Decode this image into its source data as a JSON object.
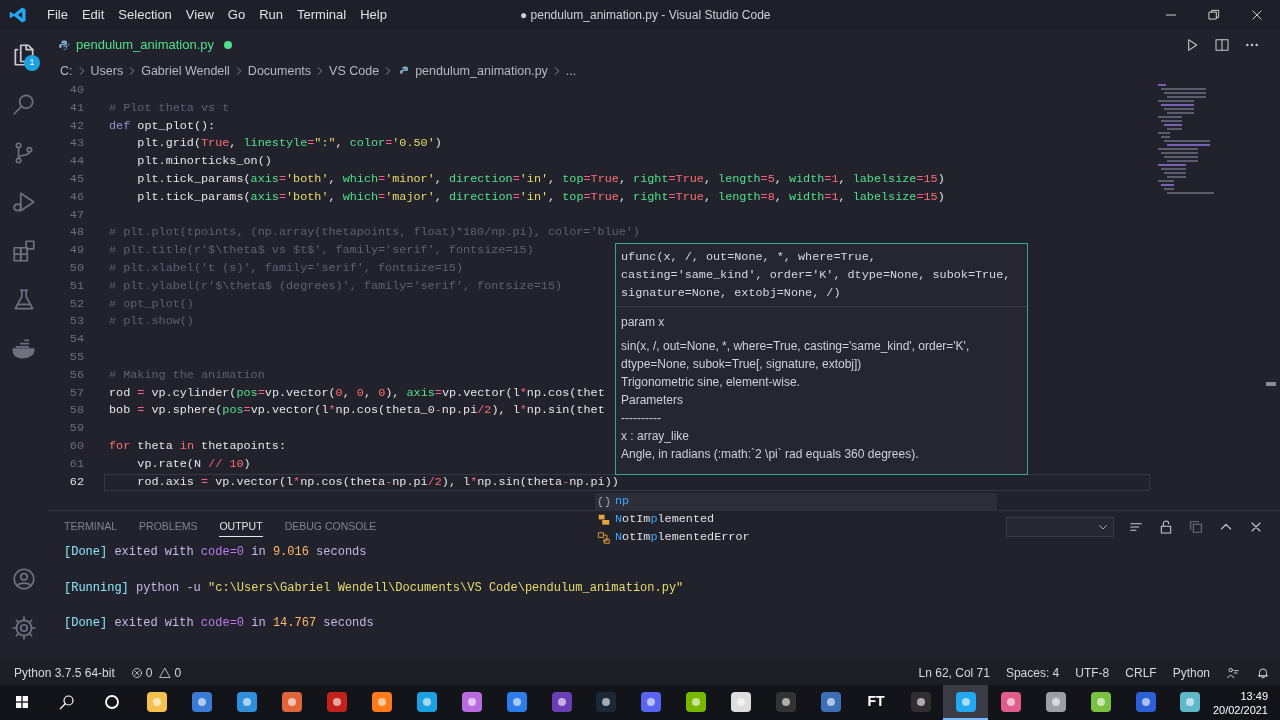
{
  "title_bar": {
    "menus": [
      "File",
      "Edit",
      "Selection",
      "View",
      "Go",
      "Run",
      "Terminal",
      "Help"
    ],
    "title": "● pendulum_animation.py - Visual Studio Code"
  },
  "activity_bar": {
    "items": [
      {
        "kind": "explorer",
        "selected": true,
        "badge": "1"
      },
      {
        "kind": "search",
        "selected": false
      },
      {
        "kind": "scm",
        "selected": false
      },
      {
        "kind": "debug",
        "selected": false
      },
      {
        "kind": "extensions",
        "selected": false
      },
      {
        "kind": "testing",
        "selected": false
      },
      {
        "kind": "docker",
        "selected": false
      }
    ],
    "bottom": [
      {
        "kind": "accounts",
        "selected": false
      },
      {
        "kind": "settings",
        "selected": false
      }
    ]
  },
  "tab": {
    "label": "pendulum_animation.py",
    "modified": true
  },
  "breadcrumb": [
    "C:",
    "Users",
    "Gabriel Wendell",
    "Documents",
    "VS Code",
    "pendulum_animation.py",
    "..."
  ],
  "editor": {
    "lines": [
      {
        "number": "40"
      },
      {
        "number": "41",
        "tokens": [
          {
            "kind": "com",
            "text": "# Plot theta vs t"
          }
        ]
      },
      {
        "number": "42",
        "tokens": [
          {
            "kind": "kw",
            "text": "def"
          },
          {
            "kind": "txt",
            "text": " opt_plot():"
          }
        ]
      },
      {
        "number": "43",
        "tokens": [
          {
            "kind": "txt",
            "text": "    plt.grid("
          },
          {
            "kind": "const",
            "text": "True"
          },
          {
            "kind": "txt",
            "text": ", "
          },
          {
            "kind": "param",
            "text": "linestyle"
          },
          {
            "kind": "op",
            "text": "="
          },
          {
            "kind": "str",
            "text": "\":\""
          },
          {
            "kind": "txt",
            "text": ", "
          },
          {
            "kind": "param",
            "text": "color"
          },
          {
            "kind": "op",
            "text": "="
          },
          {
            "kind": "str",
            "text": "'0.50'"
          },
          {
            "kind": "txt",
            "text": ")"
          }
        ]
      },
      {
        "number": "44",
        "tokens": [
          {
            "kind": "txt",
            "text": "    plt.minorticks_on()"
          }
        ]
      },
      {
        "number": "45",
        "tokens": [
          {
            "kind": "txt",
            "text": "    plt.tick_params("
          },
          {
            "kind": "param",
            "text": "axis"
          },
          {
            "kind": "op",
            "text": "="
          },
          {
            "kind": "str",
            "text": "'both'"
          },
          {
            "kind": "txt",
            "text": ", "
          },
          {
            "kind": "param",
            "text": "which"
          },
          {
            "kind": "op",
            "text": "="
          },
          {
            "kind": "str",
            "text": "'minor'"
          },
          {
            "kind": "txt",
            "text": ", "
          },
          {
            "kind": "param",
            "text": "direction"
          },
          {
            "kind": "op",
            "text": "="
          },
          {
            "kind": "str",
            "text": "'in'"
          },
          {
            "kind": "txt",
            "text": ", "
          },
          {
            "kind": "param",
            "text": "top"
          },
          {
            "kind": "op",
            "text": "="
          },
          {
            "kind": "const",
            "text": "True"
          },
          {
            "kind": "txt",
            "text": ", "
          },
          {
            "kind": "param",
            "text": "right"
          },
          {
            "kind": "op",
            "text": "="
          },
          {
            "kind": "const",
            "text": "True"
          },
          {
            "kind": "txt",
            "text": ", "
          },
          {
            "kind": "param",
            "text": "length"
          },
          {
            "kind": "op",
            "text": "="
          },
          {
            "kind": "num",
            "text": "5"
          },
          {
            "kind": "txt",
            "text": ", "
          },
          {
            "kind": "param",
            "text": "width"
          },
          {
            "kind": "op",
            "text": "="
          },
          {
            "kind": "num",
            "text": "1"
          },
          {
            "kind": "txt",
            "text": ", "
          },
          {
            "kind": "param",
            "text": "labelsize"
          },
          {
            "kind": "op",
            "text": "="
          },
          {
            "kind": "num",
            "text": "15"
          },
          {
            "kind": "txt",
            "text": ")"
          }
        ]
      },
      {
        "number": "46",
        "tokens": [
          {
            "kind": "txt",
            "text": "    plt.tick_params("
          },
          {
            "kind": "param",
            "text": "axis"
          },
          {
            "kind": "op",
            "text": "="
          },
          {
            "kind": "str",
            "text": "'both'"
          },
          {
            "kind": "txt",
            "text": ", "
          },
          {
            "kind": "param",
            "text": "which"
          },
          {
            "kind": "op",
            "text": "="
          },
          {
            "kind": "str",
            "text": "'major'"
          },
          {
            "kind": "txt",
            "text": ", "
          },
          {
            "kind": "param",
            "text": "direction"
          },
          {
            "kind": "op",
            "text": "="
          },
          {
            "kind": "str",
            "text": "'in'"
          },
          {
            "kind": "txt",
            "text": ", "
          },
          {
            "kind": "param",
            "text": "top"
          },
          {
            "kind": "op",
            "text": "="
          },
          {
            "kind": "const",
            "text": "True"
          },
          {
            "kind": "txt",
            "text": ", "
          },
          {
            "kind": "param",
            "text": "right"
          },
          {
            "kind": "op",
            "text": "="
          },
          {
            "kind": "const",
            "text": "True"
          },
          {
            "kind": "txt",
            "text": ", "
          },
          {
            "kind": "param",
            "text": "length"
          },
          {
            "kind": "op",
            "text": "="
          },
          {
            "kind": "num",
            "text": "8"
          },
          {
            "kind": "txt",
            "text": ", "
          },
          {
            "kind": "param",
            "text": "width"
          },
          {
            "kind": "op",
            "text": "="
          },
          {
            "kind": "num",
            "text": "1"
          },
          {
            "kind": "txt",
            "text": ", "
          },
          {
            "kind": "param",
            "text": "labelsize"
          },
          {
            "kind": "op",
            "text": "="
          },
          {
            "kind": "num",
            "text": "15"
          },
          {
            "kind": "txt",
            "text": ")"
          }
        ]
      },
      {
        "number": "47"
      },
      {
        "number": "48",
        "tokens": [
          {
            "kind": "com",
            "text": "# plt.plot(tpoints, (np.array(thetapoints, float)*180/np.pi), color='blue')"
          }
        ]
      },
      {
        "number": "49",
        "tokens": [
          {
            "kind": "com",
            "text": "# plt.title(r'$\\theta$ vs $t$', family='serif', fontsize=15)"
          }
        ]
      },
      {
        "number": "50",
        "tokens": [
          {
            "kind": "com",
            "text": "# plt.xlabel('t (s)', family='serif', fontsize=15)"
          }
        ]
      },
      {
        "number": "51",
        "tokens": [
          {
            "kind": "com",
            "text": "# plt.ylabel(r'$\\theta$ (degrees)', family='serif', fontsize=15)"
          }
        ]
      },
      {
        "number": "52",
        "tokens": [
          {
            "kind": "com",
            "text": "# opt_plot()"
          }
        ]
      },
      {
        "number": "53",
        "tokens": [
          {
            "kind": "com",
            "text": "# plt.show()"
          }
        ]
      },
      {
        "number": "54"
      },
      {
        "number": "55"
      },
      {
        "number": "56",
        "tokens": [
          {
            "kind": "com",
            "text": "# Making the animation"
          }
        ]
      },
      {
        "number": "57",
        "tokens": [
          {
            "kind": "txt",
            "text": "rod "
          },
          {
            "kind": "op",
            "text": "="
          },
          {
            "kind": "txt",
            "text": " vp.cylinder("
          },
          {
            "kind": "param",
            "text": "pos"
          },
          {
            "kind": "op",
            "text": "="
          },
          {
            "kind": "txt",
            "text": "vp.vector("
          },
          {
            "kind": "num",
            "text": "0"
          },
          {
            "kind": "txt",
            "text": ", "
          },
          {
            "kind": "num",
            "text": "0"
          },
          {
            "kind": "txt",
            "text": ", "
          },
          {
            "kind": "num",
            "text": "0"
          },
          {
            "kind": "txt",
            "text": "), "
          },
          {
            "kind": "param",
            "text": "axis"
          },
          {
            "kind": "op",
            "text": "="
          },
          {
            "kind": "txt",
            "text": "vp.vector(l"
          },
          {
            "kind": "op",
            "text": "*"
          },
          {
            "kind": "txt",
            "text": "np.cos(thet"
          }
        ]
      },
      {
        "number": "58",
        "tokens": [
          {
            "kind": "txt",
            "text": "bob "
          },
          {
            "kind": "op",
            "text": "="
          },
          {
            "kind": "txt",
            "text": " vp.sphere("
          },
          {
            "kind": "param",
            "text": "pos"
          },
          {
            "kind": "op",
            "text": "="
          },
          {
            "kind": "txt",
            "text": "vp.vector(l"
          },
          {
            "kind": "op",
            "text": "*"
          },
          {
            "kind": "txt",
            "text": "np.cos(theta_0"
          },
          {
            "kind": "op",
            "text": "-"
          },
          {
            "kind": "txt",
            "text": "np.pi"
          },
          {
            "kind": "op",
            "text": "/"
          },
          {
            "kind": "num",
            "text": "2"
          },
          {
            "kind": "txt",
            "text": "), l"
          },
          {
            "kind": "op",
            "text": "*"
          },
          {
            "kind": "txt",
            "text": "np.sin(thet"
          }
        ]
      },
      {
        "number": "59"
      },
      {
        "number": "60",
        "tokens": [
          {
            "kind": "kw2",
            "text": "for"
          },
          {
            "kind": "txt",
            "text": " theta "
          },
          {
            "kind": "kw2",
            "text": "in"
          },
          {
            "kind": "txt",
            "text": " thetapoints:"
          }
        ]
      },
      {
        "number": "61",
        "tokens": [
          {
            "kind": "txt",
            "text": "    vp.rate(N "
          },
          {
            "kind": "op",
            "text": "//"
          },
          {
            "kind": "num",
            "text": " 10"
          },
          {
            "kind": "txt",
            "text": ")"
          }
        ]
      },
      {
        "number": "62",
        "current": true,
        "tokens": [
          {
            "kind": "txt",
            "text": "    rod.axis "
          },
          {
            "kind": "op",
            "text": "="
          },
          {
            "kind": "txt",
            "text": " vp.vector(l"
          },
          {
            "kind": "op",
            "text": "*"
          },
          {
            "kind": "txt",
            "text": "np.cos(theta"
          },
          {
            "kind": "op",
            "text": "-"
          },
          {
            "kind": "txt",
            "text": "np.pi"
          },
          {
            "kind": "op",
            "text": "/"
          },
          {
            "kind": "num",
            "text": "2"
          },
          {
            "kind": "txt",
            "text": "), l"
          },
          {
            "kind": "op",
            "text": "*"
          },
          {
            "kind": "txt",
            "text": "np.sin(theta"
          },
          {
            "kind": "op",
            "text": "-"
          },
          {
            "kind": "txt",
            "text": "np.pi))"
          }
        ]
      }
    ]
  },
  "hover": {
    "signature": [
      "ufunc(x, /, out=None, *, where=True,",
      "casting='same_kind', order='K', dtype=None, subok=True,",
      "signature=None, extobj=None, /)"
    ],
    "docs": [
      "param x",
      "sin(x, /, out=None, *, where=True, casting='same_kind', order='K', dtype=None, subok=True[, signature, extobj])",
      "Trigonometric sine, element-wise.",
      "Parameters",
      "----------",
      "x : array_like",
      "Angle, in radians (:math:`2 \\pi` rad equals 360 degrees)."
    ]
  },
  "suggest": [
    {
      "kind": "module",
      "selected": true,
      "segments": [
        {
          "text": "np",
          "match": true
        }
      ]
    },
    {
      "kind": "constant",
      "selected": false,
      "segments": [
        {
          "text": "N",
          "match": true
        },
        {
          "text": "otIm",
          "match": false
        },
        {
          "text": "p",
          "match": true
        },
        {
          "text": "lemented",
          "match": false
        }
      ]
    },
    {
      "kind": "class",
      "selected": false,
      "segments": [
        {
          "text": "N",
          "match": true
        },
        {
          "text": "otIm",
          "match": false
        },
        {
          "text": "p",
          "match": true
        },
        {
          "text": "lementedError",
          "match": false
        }
      ]
    }
  ],
  "panel": {
    "tabs": [
      {
        "label": "TERMINAL",
        "selected": false
      },
      {
        "label": "PROBLEMS",
        "selected": false
      },
      {
        "label": "OUTPUT",
        "selected": true
      },
      {
        "label": "DEBUG CONSOLE",
        "selected": false
      }
    ],
    "output": [
      [
        {
          "kind": "tag",
          "text": "[Done]"
        },
        {
          "kind": "txt",
          "text": " exited with "
        },
        {
          "kind": "key",
          "text": "code=0"
        },
        {
          "kind": "txt",
          "text": " in "
        },
        {
          "kind": "num",
          "text": "9.016"
        },
        {
          "kind": "txt",
          "text": " seconds"
        }
      ],
      [
        {
          "kind": "tag",
          "text": "[Running]"
        },
        {
          "kind": "cmd",
          "text": " python -u "
        },
        {
          "kind": "path",
          "text": "\"c:\\Users\\Gabriel Wendell\\Documents\\VS Code\\pendulum_animation.py\""
        }
      ],
      [
        {
          "kind": "tag",
          "text": "[Done]"
        },
        {
          "kind": "txt",
          "text": " exited with "
        },
        {
          "kind": "key",
          "text": "code=0"
        },
        {
          "kind": "txt",
          "text": " in "
        },
        {
          "kind": "num",
          "text": "14.767"
        },
        {
          "kind": "txt",
          "text": " seconds"
        }
      ]
    ]
  },
  "status_bar": {
    "interpreter": "Python 3.7.5 64-bit",
    "errors": "0",
    "warnings": "0",
    "right": [
      "Ln 62, Col 71",
      "Spaces: 4",
      "UTF-8",
      "CRLF",
      "Python"
    ]
  },
  "taskbar": {
    "apps": [
      {
        "kind": "start",
        "selected": false
      },
      {
        "kind": "search",
        "selected": false
      },
      {
        "kind": "cortana",
        "selected": false
      },
      {
        "kind": "app",
        "color": "#f2c14e",
        "selected": false
      },
      {
        "kind": "app",
        "color": "#3a7bd5",
        "selected": false
      },
      {
        "kind": "app",
        "color": "#2f8fdc",
        "selected": false
      },
      {
        "kind": "app",
        "color": "#e0663a",
        "selected": false
      },
      {
        "kind": "app",
        "color": "#c4201c",
        "selected": false
      },
      {
        "kind": "app",
        "color": "#ff7a18",
        "selected": false
      },
      {
        "kind": "app",
        "color": "#1ba1e2",
        "selected": false
      },
      {
        "kind": "app",
        "color": "#b86be0",
        "selected": false
      },
      {
        "kind": "app",
        "color": "#2b7de9",
        "selected": false
      },
      {
        "kind": "app",
        "color": "#6a3fb5",
        "selected": false
      },
      {
        "kind": "app",
        "color": "#1b2838",
        "selected": false
      },
      {
        "kind": "app",
        "color": "#5865f2",
        "selected": false
      },
      {
        "kind": "app",
        "color": "#76b900",
        "selected": false
      },
      {
        "kind": "app",
        "color": "#dddddd",
        "selected": false
      },
      {
        "kind": "app",
        "color": "#333333",
        "selected": false
      },
      {
        "kind": "app",
        "color": "#3d6fb8",
        "selected": false
      },
      {
        "kind": "text",
        "label": "FT",
        "selected": false
      },
      {
        "kind": "app",
        "color": "#302e31",
        "selected": false
      },
      {
        "kind": "app",
        "color": "#23a9f2",
        "selected": true
      },
      {
        "kind": "app",
        "color": "#e05c8a",
        "selected": false
      },
      {
        "kind": "app",
        "color": "#9aa0a6",
        "selected": false
      },
      {
        "kind": "app",
        "color": "#7ac143",
        "selected": false
      },
      {
        "kind": "app",
        "color": "#2d5fd6",
        "selected": false
      },
      {
        "kind": "app",
        "color": "#5fb8c9",
        "selected": false
      }
    ],
    "time": "13:49",
    "date": "20/02/2021"
  }
}
